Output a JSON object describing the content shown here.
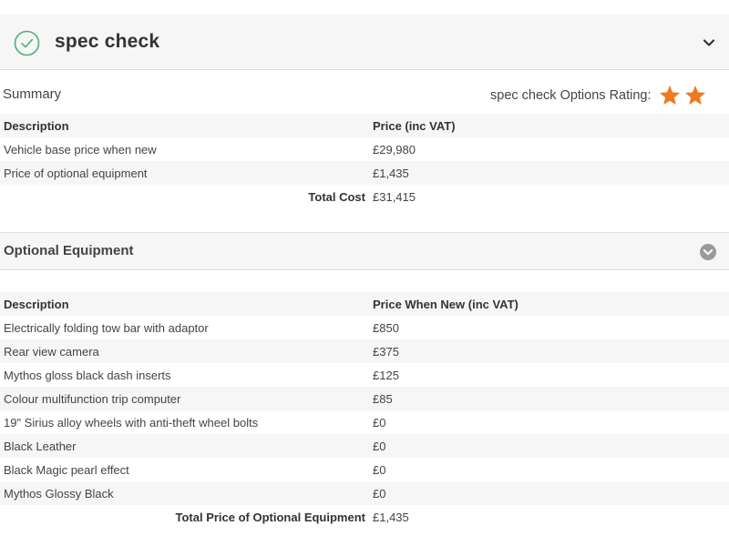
{
  "header": {
    "title": "spec check",
    "check_icon": "check-circle-icon",
    "toggle_icon": "chevron-down-icon",
    "accent_color": "#4caf7a"
  },
  "summary": {
    "label": "Summary",
    "rating_label": "spec check Options Rating:",
    "rating_stars": 2,
    "star_color": "#ee7a1e",
    "columns": [
      "Description",
      "Price (inc VAT)"
    ],
    "rows": [
      {
        "description": "Vehicle base price when new",
        "price": "£29,980"
      },
      {
        "description": "Price of optional equipment",
        "price": "£1,435"
      }
    ],
    "total_label": "Total Cost",
    "total_value": "£31,415"
  },
  "optional": {
    "title": "Optional Equipment",
    "toggle_icon": "chevron-down-circle-icon",
    "columns": [
      "Description",
      "Price When New (inc VAT)"
    ],
    "rows": [
      {
        "description": "Electrically folding tow bar with adaptor",
        "price": "£850"
      },
      {
        "description": "Rear view camera",
        "price": "£375"
      },
      {
        "description": "Mythos gloss black dash inserts",
        "price": "£125"
      },
      {
        "description": "Colour multifunction trip computer",
        "price": "£85"
      },
      {
        "description": "19\" Sirius alloy wheels with anti-theft wheel bolts",
        "price": "£0"
      },
      {
        "description": "Black Leather",
        "price": "£0"
      },
      {
        "description": "Black Magic pearl effect",
        "price": "£0"
      },
      {
        "description": "Mythos Glossy Black",
        "price": "£0"
      }
    ],
    "total_label": "Total Price of Optional Equipment",
    "total_value": "£1,435"
  }
}
